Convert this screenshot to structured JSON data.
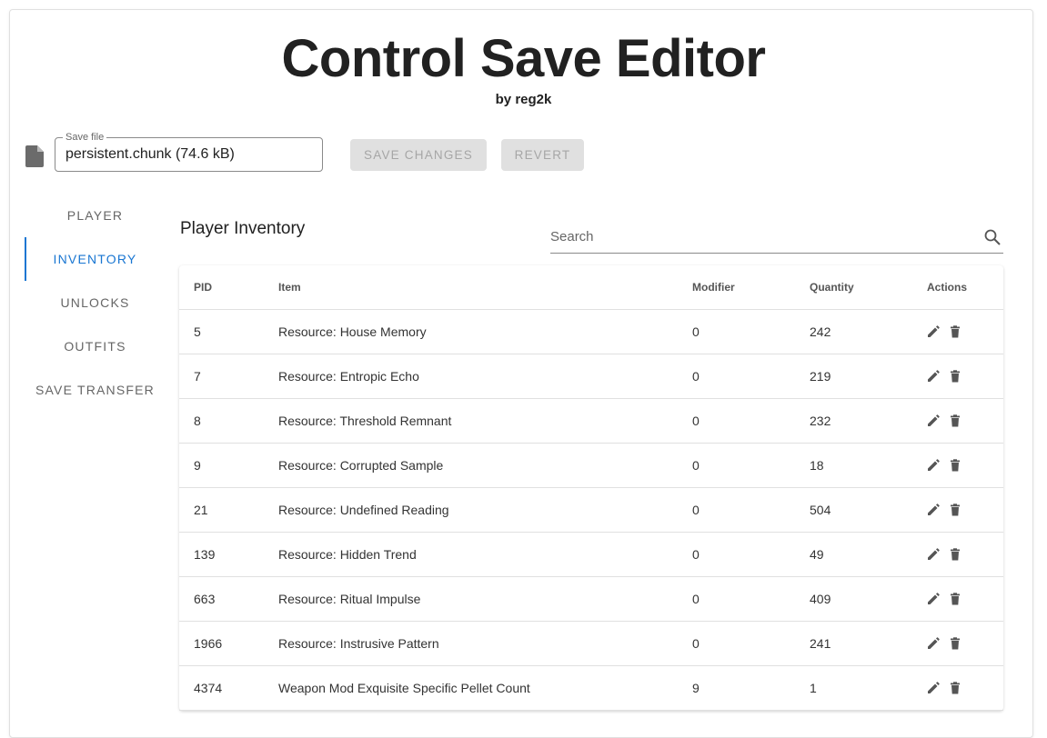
{
  "app": {
    "title": "Control Save Editor",
    "subtitle": "by reg2k"
  },
  "toolbar": {
    "save_file_label": "Save file",
    "save_file_value": "persistent.chunk (74.6 kB)",
    "save_changes_label": "SAVE CHANGES",
    "revert_label": "REVERT",
    "file_icon": "file-icon"
  },
  "sidebar": {
    "items": [
      {
        "label": "PLAYER",
        "active": false
      },
      {
        "label": "INVENTORY",
        "active": true
      },
      {
        "label": "UNLOCKS",
        "active": false
      },
      {
        "label": "OUTFITS",
        "active": false
      },
      {
        "label": "SAVE TRANSFER",
        "active": false
      }
    ]
  },
  "inventory": {
    "title": "Player Inventory",
    "search_placeholder": "Search",
    "columns": [
      "PID",
      "Item",
      "Modifier",
      "Quantity",
      "Actions"
    ],
    "rows": [
      {
        "pid": "5",
        "item": "Resource: House Memory",
        "modifier": "0",
        "quantity": "242"
      },
      {
        "pid": "7",
        "item": "Resource: Entropic Echo",
        "modifier": "0",
        "quantity": "219"
      },
      {
        "pid": "8",
        "item": "Resource: Threshold Remnant",
        "modifier": "0",
        "quantity": "232"
      },
      {
        "pid": "9",
        "item": "Resource: Corrupted Sample",
        "modifier": "0",
        "quantity": "18"
      },
      {
        "pid": "21",
        "item": "Resource: Undefined Reading",
        "modifier": "0",
        "quantity": "504"
      },
      {
        "pid": "139",
        "item": "Resource: Hidden Trend",
        "modifier": "0",
        "quantity": "49"
      },
      {
        "pid": "663",
        "item": "Resource: Ritual Impulse",
        "modifier": "0",
        "quantity": "409"
      },
      {
        "pid": "1966",
        "item": "Resource: Instrusive Pattern",
        "modifier": "0",
        "quantity": "241"
      },
      {
        "pid": "4374",
        "item": "Weapon Mod Exquisite Specific Pellet Count",
        "modifier": "9",
        "quantity": "1"
      }
    ]
  },
  "colors": {
    "accent": "#1976d2",
    "disabled_button_bg": "#e0e0e0",
    "disabled_button_text": "#a6a6a6"
  }
}
